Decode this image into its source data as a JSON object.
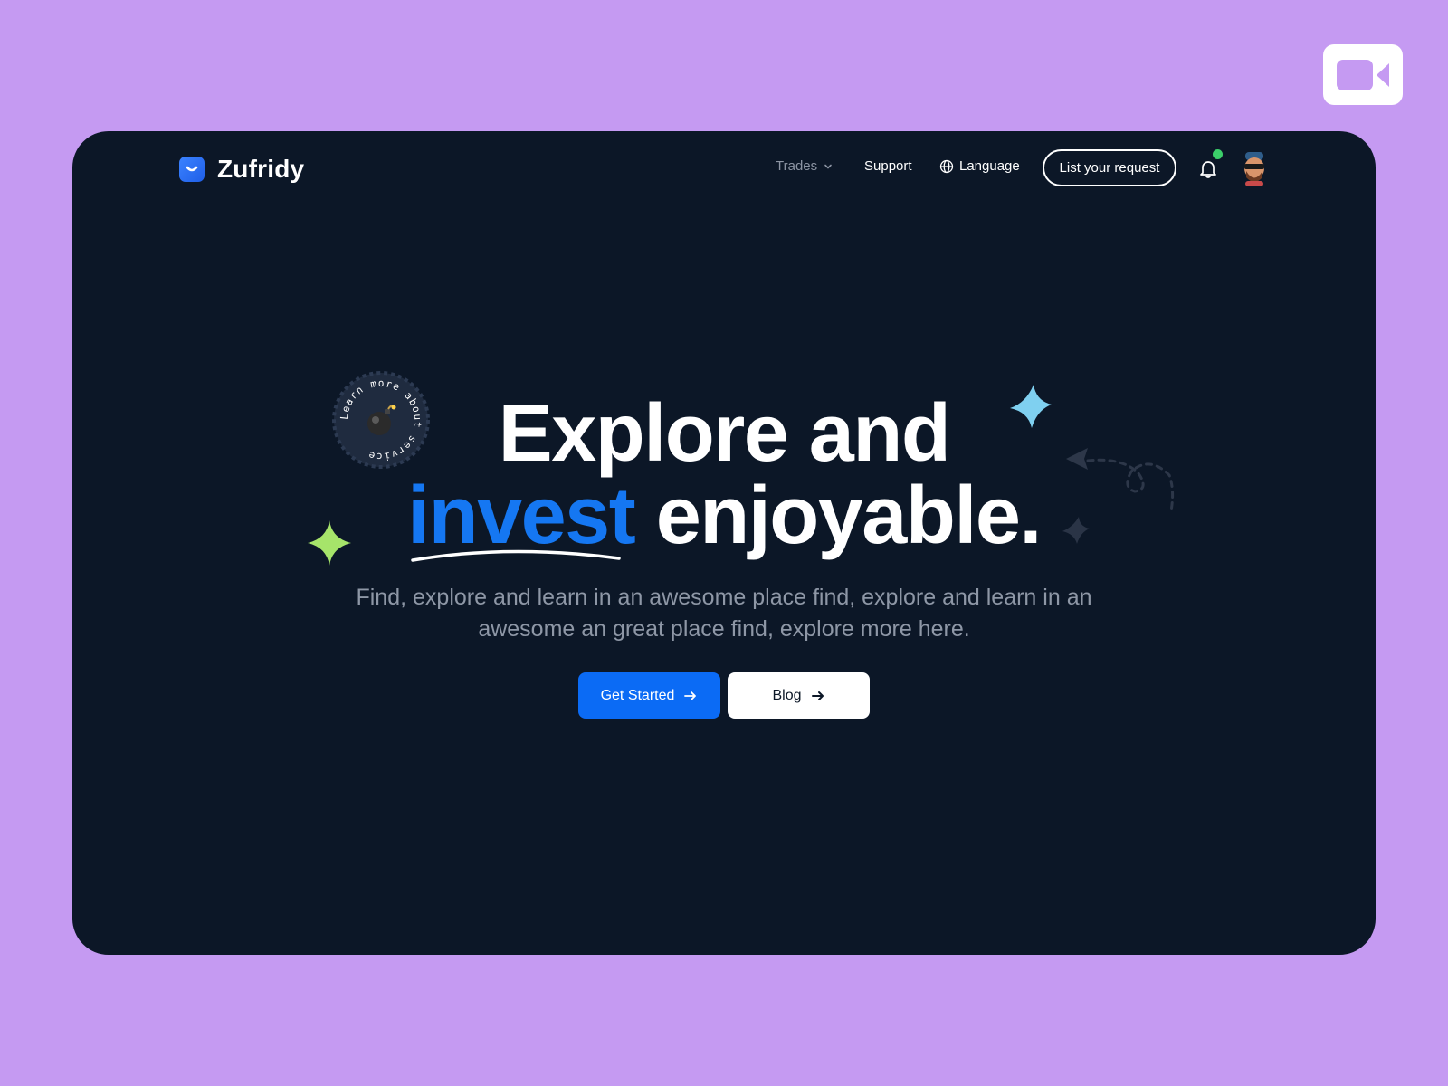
{
  "brand": {
    "name": "Zufridy"
  },
  "nav": {
    "trades": "Trades",
    "support": "Support",
    "language": "Language",
    "list_request": "List your request"
  },
  "hero": {
    "title_line1": "Explore and",
    "title_accent": "invest",
    "title_rest": " enjoyable.",
    "subtitle": "Find, explore and learn in an awesome place find, explore and learn in an awesome an great place find, explore more here.",
    "badge_text": "Learn more about service ",
    "primary_cta": "Get Started",
    "secondary_cta": "Blog"
  },
  "icons": {
    "video": "video-camera-icon",
    "logo": "smile-logo-icon",
    "chevron": "chevron-down-icon",
    "globe": "globe-icon",
    "bell": "bell-icon",
    "arrow": "arrow-right-icon",
    "bomb": "bomb-icon"
  },
  "colors": {
    "page_bg": "#c59af2",
    "card_bg": "#0c1727",
    "accent": "#1577f2",
    "primary_button": "#0b6bf5",
    "notification_dot": "#3ccf6a",
    "star_blue": "#7fd0f0",
    "star_green": "#a6e46a"
  }
}
